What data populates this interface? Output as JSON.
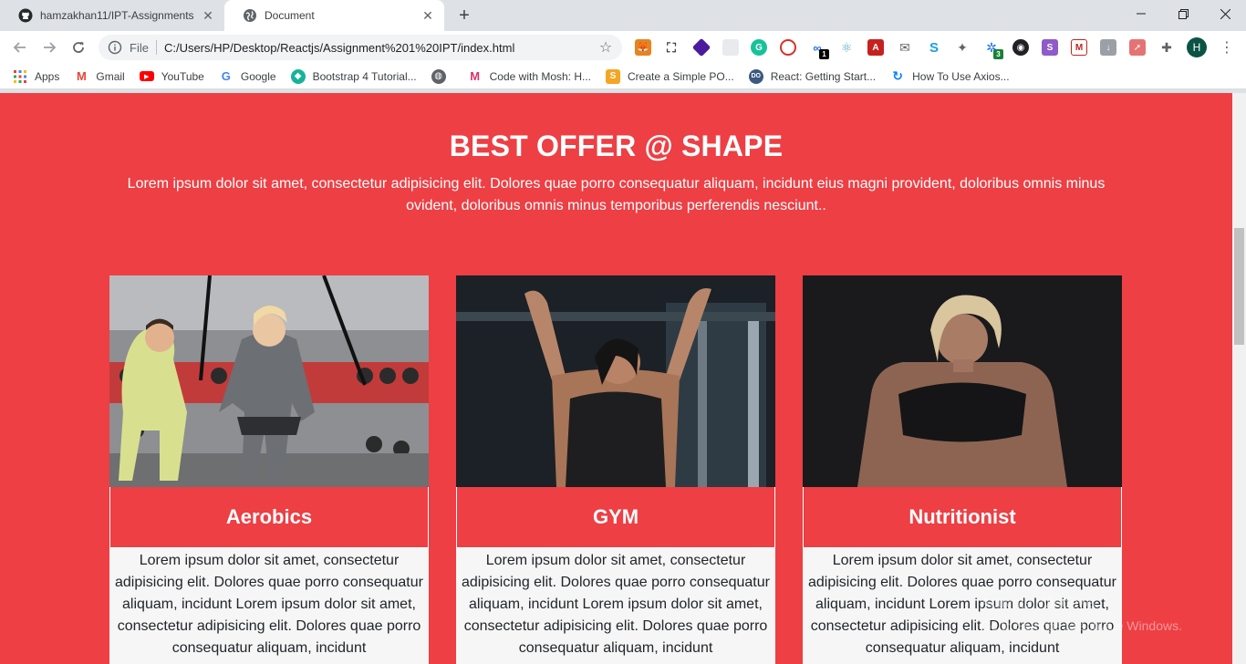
{
  "browser": {
    "tabs": [
      {
        "title": "hamzakhan11/IPT-Assignments",
        "icon": "github-icon",
        "active": false
      },
      {
        "title": "Document",
        "icon": "globe-icon",
        "active": true
      }
    ],
    "address": {
      "scheme_label": "File",
      "url": "C:/Users/HP/Desktop/Reactjs/Assignment%201%20IPT/index.html"
    },
    "extension_badges": {
      "first": "1",
      "second": "3"
    },
    "profile_initial": "H",
    "bookmarks": [
      {
        "label": "Apps",
        "icon": "apps-grid-icon"
      },
      {
        "label": "Gmail",
        "icon": "gmail-icon"
      },
      {
        "label": "YouTube",
        "icon": "youtube-icon"
      },
      {
        "label": "Google",
        "icon": "google-icon"
      },
      {
        "label": "Bootstrap 4 Tutorial...",
        "icon": "bootstrap-icon"
      },
      {
        "label": "",
        "icon": "globe-icon"
      },
      {
        "label": "Code with Mosh: H...",
        "icon": "mosh-icon"
      },
      {
        "label": "Create a Simple PO...",
        "icon": "stackabuse-icon"
      },
      {
        "label": "React: Getting Start...",
        "icon": "digitalocean-icon"
      },
      {
        "label": "How To Use Axios...",
        "icon": "digitalocean-swirl-icon"
      }
    ]
  },
  "page": {
    "hero": {
      "title": "BEST OFFER @ SHAPE",
      "text": "Lorem ipsum dolor sit amet, consectetur adipisicing elit. Dolores quae porro consequatur aliquam, incidunt eius magni provident, doloribus omnis minus ovident, doloribus omnis minus temporibus perferendis nesciunt.."
    },
    "cards": [
      {
        "title": "Aerobics",
        "text": "Lorem ipsum dolor sit amet, consectetur adipisicing elit. Dolores quae porro consequatur aliquam, incidunt Lorem ipsum dolor sit amet, consectetur adipisicing elit. Dolores quae porro consequatur aliquam, incidunt"
      },
      {
        "title": "GYM",
        "text": "Lorem ipsum dolor sit amet, consectetur adipisicing elit. Dolores quae porro consequatur aliquam, incidunt Lorem ipsum dolor sit amet, consectetur adipisicing elit. Dolores quae porro consequatur aliquam, incidunt"
      },
      {
        "title": "Nutritionist",
        "text": "Lorem ipsum dolor sit amet, consectetur adipisicing elit. Dolores quae porro consequatur aliquam, incidunt Lorem ipsum dolor sit amet, consectetur adipisicing elit. Dolores quae porro consequatur aliquam, incidunt"
      }
    ],
    "watermark": {
      "line1": "Activate Windows",
      "line2": "Go to Settings to activate Windows."
    }
  },
  "colors": {
    "page_bg": "#ed3f44",
    "card_body_bg": "#f6f6f6",
    "tab_strip": "#dee1e6"
  }
}
